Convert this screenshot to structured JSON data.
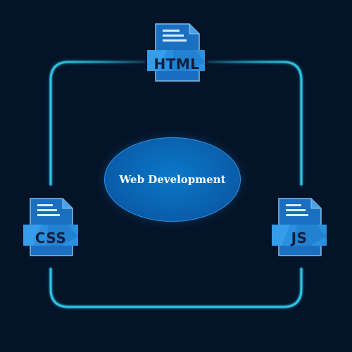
{
  "center": {
    "title": "Web Development"
  },
  "files": {
    "html": {
      "label": "HTML",
      "icon": "html-file-icon"
    },
    "css": {
      "label": "CSS",
      "icon": "css-file-icon"
    },
    "js": {
      "label": "JS",
      "icon": "js-file-icon"
    }
  },
  "colors": {
    "background": "#041428",
    "connector": "#2bc3e6",
    "file_face": "#1a6fc0",
    "label_band": "#2b8fe0",
    "center_fill": "#0a68b8"
  }
}
